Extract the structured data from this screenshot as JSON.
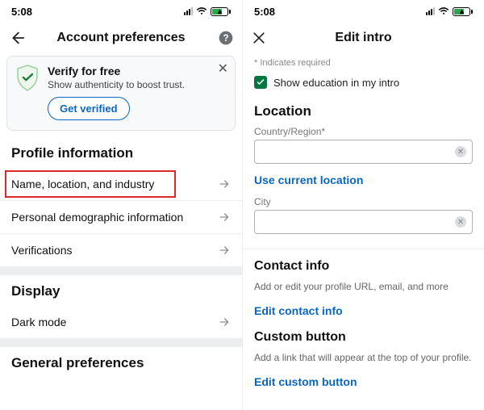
{
  "status": {
    "time": "5:08"
  },
  "left": {
    "header": {
      "title": "Account preferences"
    },
    "verify": {
      "title": "Verify for free",
      "subtitle": "Show authenticity to boost trust.",
      "cta": "Get verified"
    },
    "sections": {
      "profile_info_h": "Profile information",
      "rows": {
        "name_location": "Name, location, and industry",
        "demographic": "Personal demographic information",
        "verifications": "Verifications"
      },
      "display_h": "Display",
      "dark_mode": "Dark mode",
      "general_prefs_h": "General preferences"
    }
  },
  "right": {
    "header": {
      "title": "Edit intro"
    },
    "required_note": "* Indicates required",
    "show_edu_label": "Show education in my intro",
    "location_h": "Location",
    "country_label": "Country/Region*",
    "use_current": "Use current location",
    "city_label": "City",
    "contact_h": "Contact info",
    "contact_sub": "Add or edit your profile URL, email, and more",
    "edit_contact": "Edit contact info",
    "custom_h": "Custom button",
    "custom_sub": "Add a link that will appear at the top of your profile.",
    "edit_custom": "Edit custom button"
  }
}
